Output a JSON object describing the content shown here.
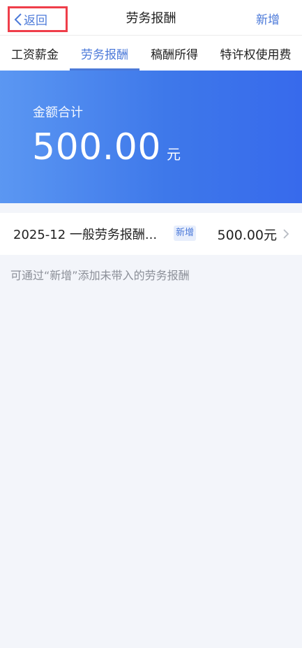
{
  "nav": {
    "back_label": "返回",
    "title": "劳务报酬",
    "add_label": "新增"
  },
  "tabs": [
    {
      "label": "工资薪金",
      "active": false
    },
    {
      "label": "劳务报酬",
      "active": true
    },
    {
      "label": "稿酬所得",
      "active": false
    },
    {
      "label": "特许权使用费",
      "active": false
    }
  ],
  "summary": {
    "label": "金额合计",
    "amount": "500.00",
    "unit": "元"
  },
  "records": [
    {
      "title": "2025-12 一般劳务报酬...",
      "badge": "新增",
      "amount": "500.00元"
    }
  ],
  "hint": "可通过“新增”添加未带入的劳务报酬",
  "colors": {
    "accent": "#4b79d9",
    "highlight_border": "#ef3e4a",
    "card_gradient_start": "#5b97f2",
    "card_gradient_end": "#376aec",
    "background": "#f3f5fa"
  },
  "icons": {
    "back": "chevron-left-icon",
    "row_arrow": "chevron-right-icon"
  }
}
